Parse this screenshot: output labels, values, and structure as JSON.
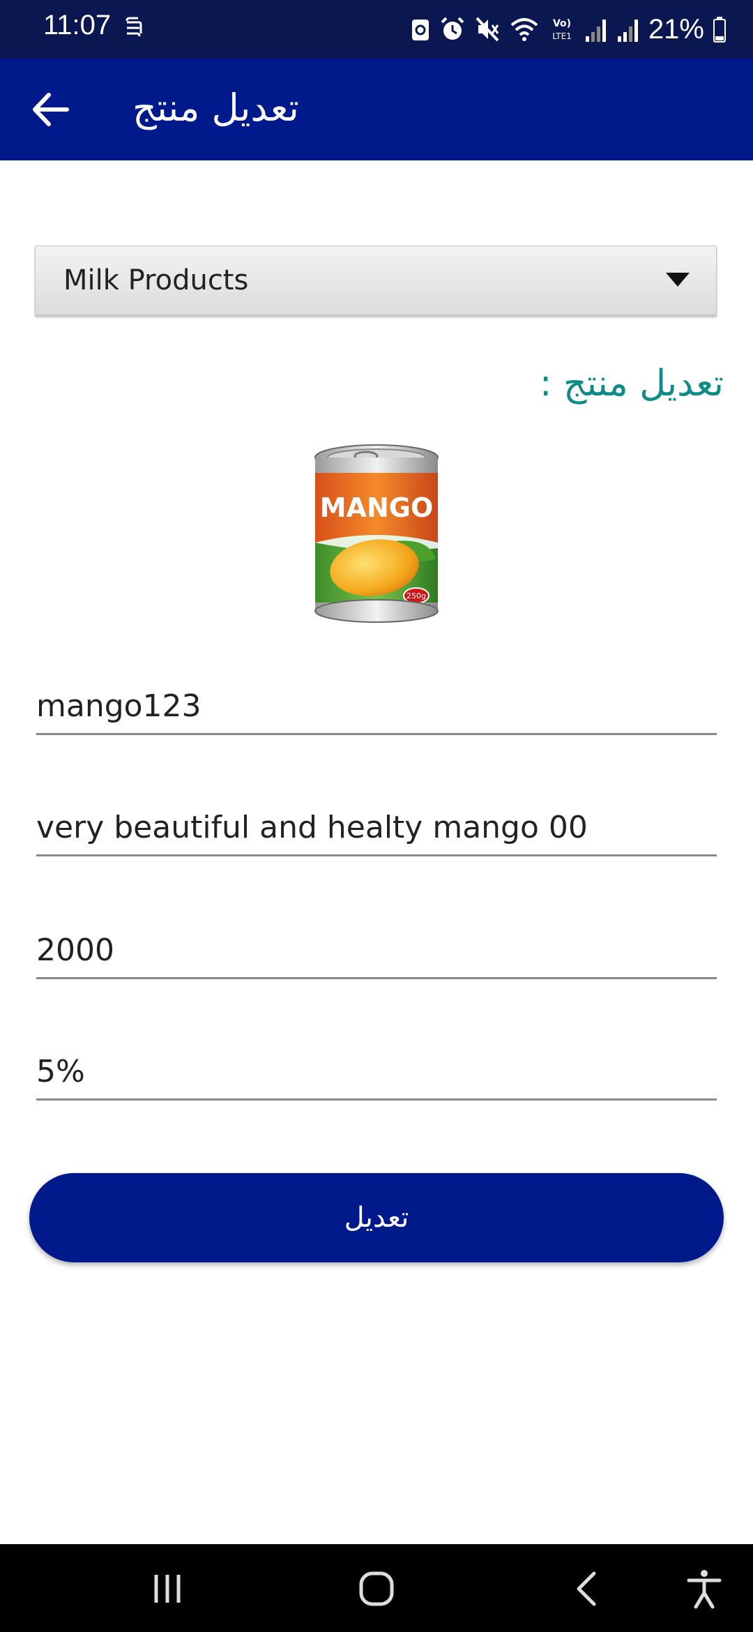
{
  "status_bar": {
    "time": "11:07",
    "battery": "21%"
  },
  "app_bar": {
    "title": "تعديل منتج"
  },
  "category_dropdown": {
    "selected": "Milk Products"
  },
  "section_label": "تعديل منتج :",
  "product_image": {
    "brand_text": "MANGO",
    "weight_text": "250g"
  },
  "form": {
    "name": "mango123",
    "description": "very beautiful and healty mango 00",
    "price": "2000",
    "discount": "5%"
  },
  "submit_button": {
    "label": "تعديل"
  },
  "colors": {
    "status_bar": "#0a1750",
    "app_bar": "#001a8c",
    "accent_teal": "#0d8b86",
    "button": "#001a8c"
  }
}
